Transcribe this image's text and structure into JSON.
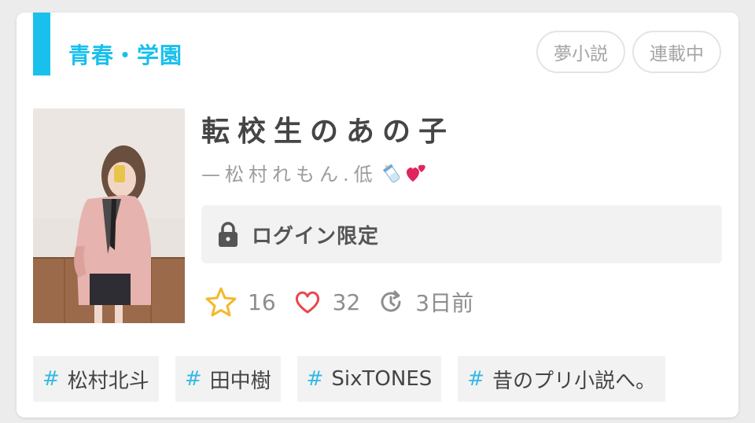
{
  "colors": {
    "accent": "#19c0ec",
    "star": "#f5b82e",
    "heart": "#e8484f"
  },
  "card": {
    "genre": "青春・学園",
    "badges": [
      "夢小説",
      "連載中"
    ],
    "title": "転校生のあの子",
    "author": "—松村れもん.低",
    "author_emoji": [
      "baby-bottle-icon",
      "two-hearts-icon"
    ],
    "access": {
      "icon": "lock-icon",
      "label": "ログイン限定"
    },
    "stats": {
      "stars": "16",
      "likes": "32",
      "updated": "3日前"
    },
    "tags": [
      "松村北斗",
      "田中樹",
      "SixTONES",
      "昔のプリ小説へ。"
    ],
    "tag_prefix": "#"
  }
}
